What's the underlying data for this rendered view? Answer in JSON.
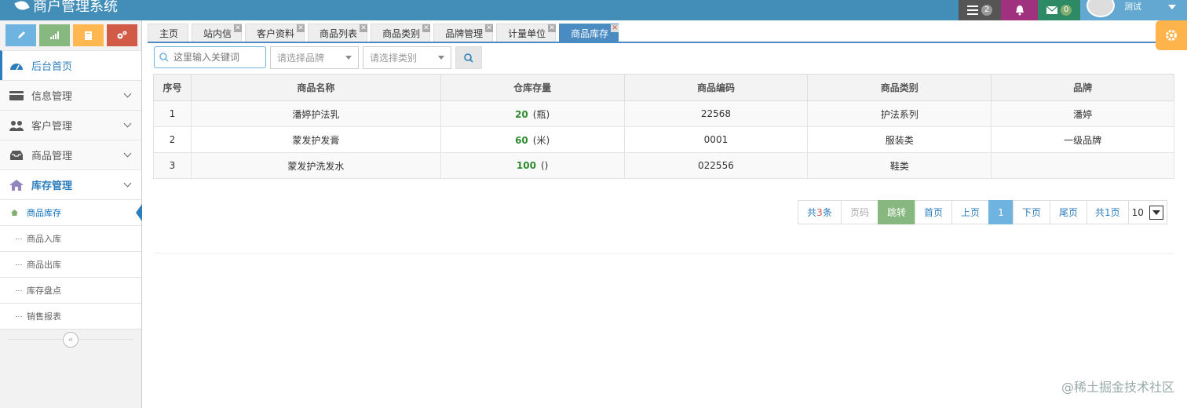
{
  "app": {
    "title": "商户管理系统"
  },
  "header": {
    "tasks_count": "2",
    "mail_count": "0",
    "user_name": "测试"
  },
  "sidebar": {
    "items": [
      {
        "label": "后台首页"
      },
      {
        "label": "信息管理"
      },
      {
        "label": "客户管理"
      },
      {
        "label": "商品管理"
      },
      {
        "label": "库存管理"
      }
    ],
    "submenu": [
      {
        "label": "商品库存"
      },
      {
        "label": "商品入库"
      },
      {
        "label": "商品出库"
      },
      {
        "label": "库存盘点"
      },
      {
        "label": "销售报表"
      }
    ],
    "collapse_glyph": "«"
  },
  "tabs": [
    {
      "label": "主页"
    },
    {
      "label": "站内信"
    },
    {
      "label": "客户资料"
    },
    {
      "label": "商品列表"
    },
    {
      "label": "商品类别"
    },
    {
      "label": "品牌管理"
    },
    {
      "label": "计量单位"
    },
    {
      "label": "商品库存"
    }
  ],
  "search": {
    "placeholder": "这里输入关键词",
    "brand_placeholder": "请选择品牌",
    "category_placeholder": "请选择类别"
  },
  "table": {
    "headers": [
      "序号",
      "商品名称",
      "仓库存量",
      "商品编码",
      "商品类别",
      "品牌"
    ],
    "rows": [
      {
        "no": "1",
        "name": "潘婷护法乳",
        "qty": "20",
        "unit": "(瓶)",
        "code": "22568",
        "category": "护法系列",
        "brand": "潘婷"
      },
      {
        "no": "2",
        "name": "蒙发护发膏",
        "qty": "60",
        "unit": "(米)",
        "code": "0001",
        "category": "服装类",
        "brand": "一级品牌"
      },
      {
        "no": "3",
        "name": "蒙发护洗发水",
        "qty": "100",
        "unit": "()",
        "code": "022556",
        "category": "鞋类",
        "brand": ""
      }
    ]
  },
  "pager": {
    "total_prefix": "共",
    "total_count": "3",
    "total_suffix": "条",
    "page_input_placeholder": "页码",
    "jump": "跳转",
    "first": "首页",
    "prev": "上页",
    "current": "1",
    "next": "下页",
    "last": "尾页",
    "pages": "共1页",
    "page_size": "10"
  },
  "watermark": "@稀土掘金技术社区"
}
